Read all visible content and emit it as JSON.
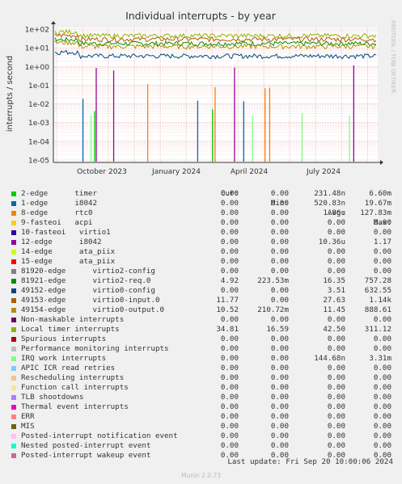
{
  "chart_data": {
    "type": "line",
    "title": "Individual interrupts - by year",
    "ylabel": "interrupts / second",
    "yscale": "log",
    "ylim": [
      1e-05,
      100
    ],
    "y_ticks": [
      "1e+02",
      "1e+01",
      "1e+00",
      "1e-01",
      "1e-02",
      "1e-03",
      "1e-04",
      "1e-05"
    ],
    "x_ticks": [
      "October 2023",
      "January 2024",
      "April 2024",
      "July 2024"
    ],
    "watermark": "RRDTOOL / TOBI OETIKER",
    "grid": true,
    "legend_columns": [
      "Cur:",
      "Min:",
      "Avg:",
      "Max:"
    ],
    "series": [
      {
        "name": "2-edge      timer",
        "color": "#00cc00",
        "cur": "0.00",
        "min": "0.00",
        "avg": "231.48n",
        "max": "6.60m"
      },
      {
        "name": "1-edge      i8042",
        "color": "#0066b3",
        "cur": "0.00",
        "min": "0.00",
        "avg": "520.83n",
        "max": "19.67m"
      },
      {
        "name": "8-edge      rtc0",
        "color": "#ff8000",
        "cur": "0.00",
        "min": "0.00",
        "avg": "1.86u",
        "max": "127.83m"
      },
      {
        "name": "9-fasteoi   acpi",
        "color": "#ffcc00",
        "cur": "0.00",
        "min": "0.00",
        "avg": "0.00",
        "max": "0.00"
      },
      {
        "name": "10-fasteoi   virtio1",
        "color": "#330099",
        "cur": "0.00",
        "min": "0.00",
        "avg": "0.00",
        "max": "0.00"
      },
      {
        "name": "12-edge      i8042",
        "color": "#990099",
        "cur": "0.00",
        "min": "0.00",
        "avg": "10.36u",
        "max": "1.17"
      },
      {
        "name": "14-edge      ata_piix",
        "color": "#ccff00",
        "cur": "0.00",
        "min": "0.00",
        "avg": "0.00",
        "max": "0.00"
      },
      {
        "name": "15-edge      ata_piix",
        "color": "#ff0000",
        "cur": "0.00",
        "min": "0.00",
        "avg": "0.00",
        "max": "0.00"
      },
      {
        "name": "81920-edge      virtio2-config",
        "color": "#808080",
        "cur": "0.00",
        "min": "0.00",
        "avg": "0.00",
        "max": "0.00"
      },
      {
        "name": "81921-edge      virtio2-req.0",
        "color": "#008f00",
        "cur": "4.92",
        "min": "223.53m",
        "avg": "16.35",
        "max": "757.28"
      },
      {
        "name": "49152-edge      virtio0-config",
        "color": "#00487d",
        "cur": "0.00",
        "min": "0.00",
        "avg": "3.51",
        "max": "632.55"
      },
      {
        "name": "49153-edge      virtio0-input.0",
        "color": "#b35a00",
        "cur": "11.77",
        "min": "0.00",
        "avg": "27.63",
        "max": "1.14k"
      },
      {
        "name": "49154-edge      virtio0-output.0",
        "color": "#b38f00",
        "cur": "10.52",
        "min": "210.72m",
        "avg": "11.45",
        "max": "888.61"
      },
      {
        "name": "Non-maskable interrupts",
        "color": "#6b006b",
        "cur": "0.00",
        "min": "0.00",
        "avg": "0.00",
        "max": "0.00"
      },
      {
        "name": "Local timer interrupts",
        "color": "#8fb300",
        "cur": "34.81",
        "min": "16.59",
        "avg": "42.50",
        "max": "311.12"
      },
      {
        "name": "Spurious interrupts",
        "color": "#b30000",
        "cur": "0.00",
        "min": "0.00",
        "avg": "0.00",
        "max": "0.00"
      },
      {
        "name": "Performance monitoring interrupts",
        "color": "#bebebe",
        "cur": "0.00",
        "min": "0.00",
        "avg": "0.00",
        "max": "0.00"
      },
      {
        "name": "IRQ work interrupts",
        "color": "#80ff80",
        "cur": "0.00",
        "min": "0.00",
        "avg": "144.68n",
        "max": "3.31m"
      },
      {
        "name": "APIC ICR read retries",
        "color": "#80c9ff",
        "cur": "0.00",
        "min": "0.00",
        "avg": "0.00",
        "max": "0.00"
      },
      {
        "name": "Rescheduling interrupts",
        "color": "#ffc080",
        "cur": "0.00",
        "min": "0.00",
        "avg": "0.00",
        "max": "0.00"
      },
      {
        "name": "Function call interrupts",
        "color": "#ffe680",
        "cur": "0.00",
        "min": "0.00",
        "avg": "0.00",
        "max": "0.00"
      },
      {
        "name": "TLB shootdowns",
        "color": "#aa80ff",
        "cur": "0.00",
        "min": "0.00",
        "avg": "0.00",
        "max": "0.00"
      },
      {
        "name": "Thermal event interrupts",
        "color": "#ee00cc",
        "cur": "0.00",
        "min": "0.00",
        "avg": "0.00",
        "max": "0.00"
      },
      {
        "name": "ERR",
        "color": "#ff8080",
        "cur": "0.00",
        "min": "0.00",
        "avg": "0.00",
        "max": "0.00"
      },
      {
        "name": "MIS",
        "color": "#666600",
        "cur": "0.00",
        "min": "0.00",
        "avg": "0.00",
        "max": "0.00"
      },
      {
        "name": "Posted-interrupt notification event",
        "color": "#ffbfff",
        "cur": "0.00",
        "min": "0.00",
        "avg": "0.00",
        "max": "0.00"
      },
      {
        "name": "Nested posted-interrupt event",
        "color": "#00ffcc",
        "cur": "0.00",
        "min": "0.00",
        "avg": "0.00",
        "max": "0.00"
      },
      {
        "name": "Posted-interrupt wakeup event",
        "color": "#cc6699",
        "cur": "0.00",
        "min": "0.00",
        "avg": "0.00",
        "max": "0.00"
      }
    ],
    "footer": "Last update: Fri Sep 20 10:00:06 2024",
    "munin_version": "Munin 2.0.73"
  }
}
